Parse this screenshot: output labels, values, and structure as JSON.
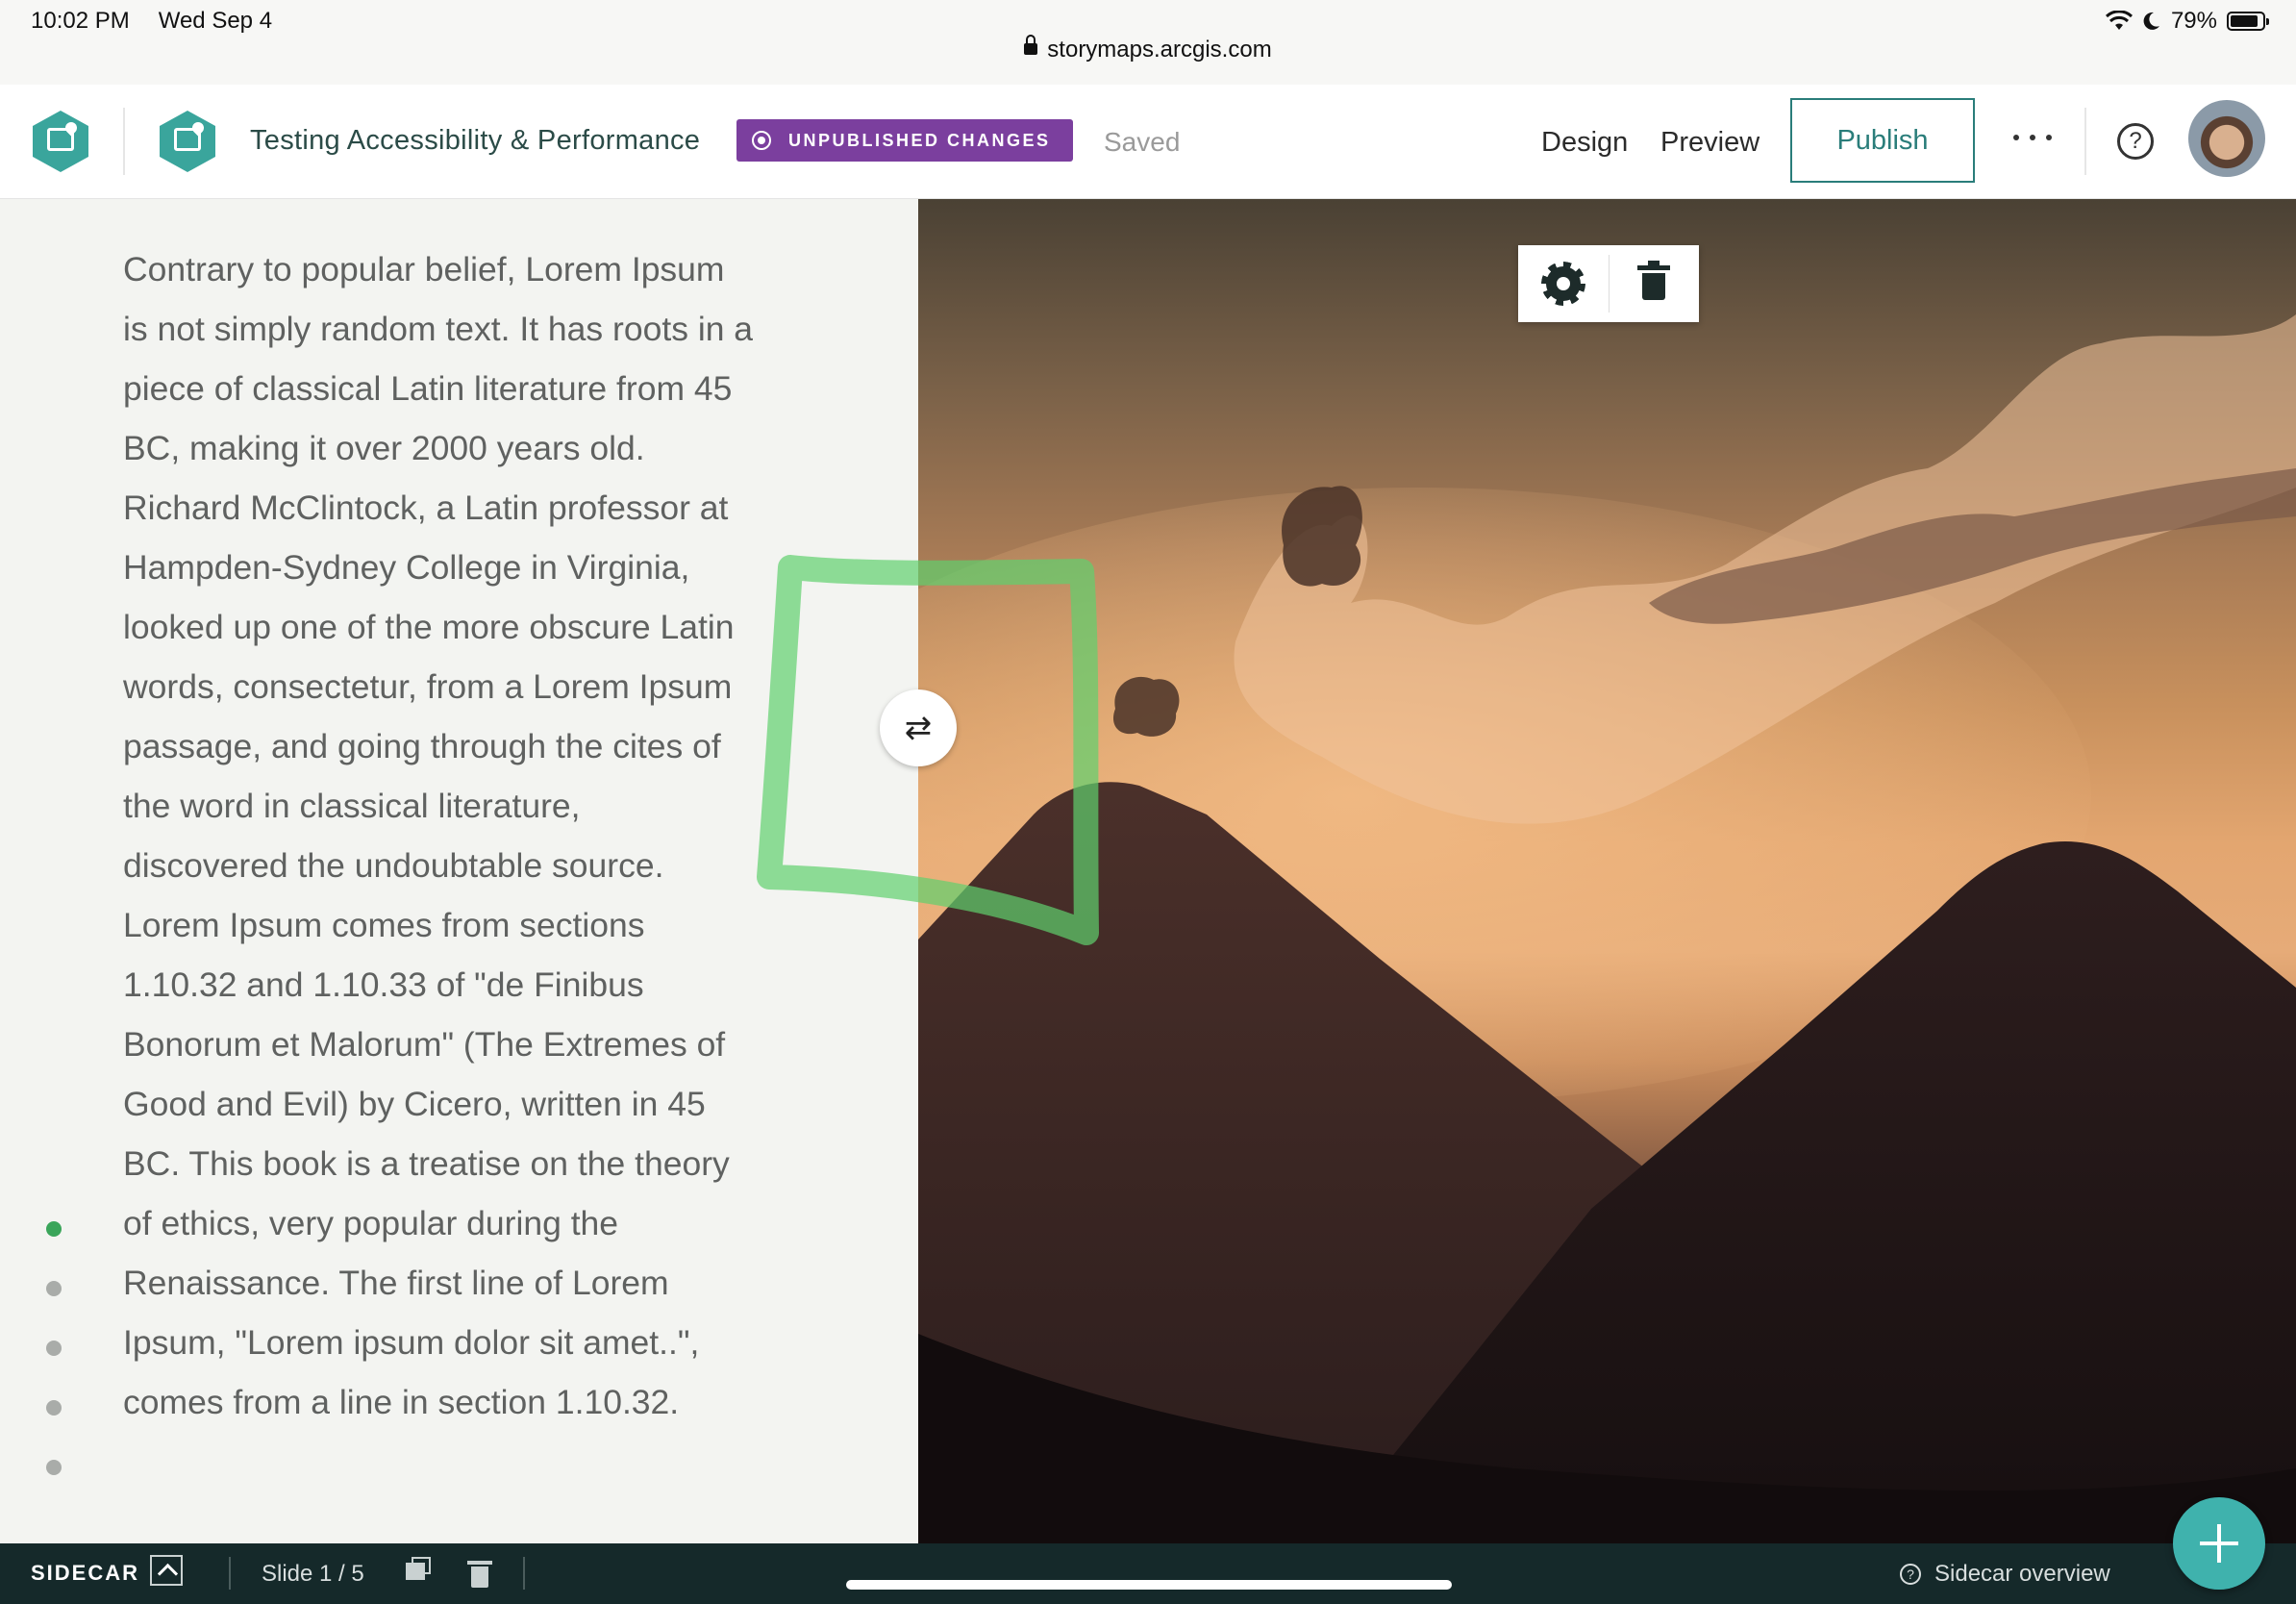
{
  "status_bar": {
    "time": "10:02 PM",
    "date": "Wed Sep 4",
    "url": "storymaps.arcgis.com",
    "battery": "79%"
  },
  "header": {
    "story_title": "Testing Accessibility & Performance",
    "badge": "UNPUBLISHED CHANGES",
    "save_status": "Saved",
    "design_label": "Design",
    "preview_label": "Preview",
    "publish_label": "Publish",
    "help_glyph": "?"
  },
  "content": {
    "lines": [
      "Contrary to popular belief, Lorem Ipsum",
      "is not simply random text. It has roots in a",
      "piece of classical Latin literature from 45",
      "BC, making it over 2000 years old.",
      "Richard McClintock, a Latin professor at",
      "Hampden-Sydney College in Virginia,",
      "looked up one of the more obscure Latin",
      "words, consectetur, from a Lorem Ipsum",
      "passage, and going through the cites of",
      "the word in classical literature,",
      "discovered the undoubtable source.",
      "Lorem Ipsum comes from sections",
      "1.10.32 and 1.10.33 of \"de Finibus",
      "Bonorum et Malorum\" (The Extremes of",
      "Good and Evil) by Cicero, written in 45",
      "BC. This book is a treatise on the theory",
      "of ethics, very popular during the",
      "Renaissance. The first line of Lorem",
      "Ipsum, \"Lorem ipsum dolor sit amet..\",",
      "comes from a line in section 1.10.32."
    ]
  },
  "slide_nav": {
    "total": 5,
    "active_index": 0
  },
  "media": {
    "swap_glyph": "⇄"
  },
  "bottom_bar": {
    "mode_label": "SIDECAR",
    "slide_counter": "Slide 1 / 5",
    "overview_label": "Sidecar overview"
  },
  "colors": {
    "accent": "#3aa59c",
    "publish_border": "#2a7d7a",
    "badge_bg": "#7b3f9e",
    "bottom_bar_bg": "#15292a",
    "active_dot": "#3aa55a",
    "annotation": "#5fd06e"
  },
  "icons": [
    "lock-icon",
    "wifi-icon",
    "moon-icon",
    "battery-icon",
    "storymaps-logo-icon",
    "unpublished-icon",
    "more-icon",
    "help-icon",
    "gear-icon",
    "trash-icon",
    "swap-icon",
    "chevron-up-icon",
    "duplicate-icon",
    "question-icon",
    "plus-icon"
  ]
}
